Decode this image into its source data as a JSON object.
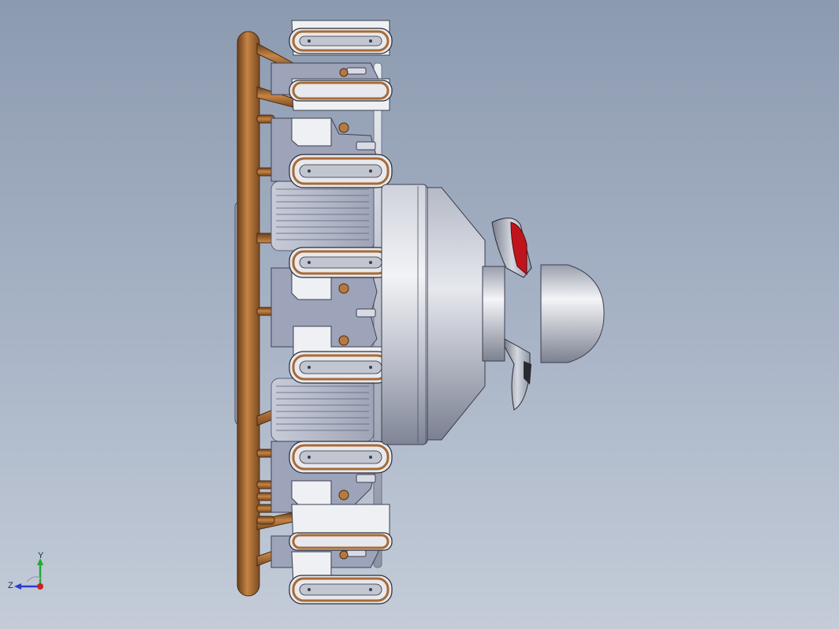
{
  "viewport": {
    "background_top": "#8c9ab0",
    "background_bottom": "#c4ccd8"
  },
  "colors": {
    "copper": "#a76a36",
    "copper_light": "#d59a5e",
    "steel": "#c9ccd6",
    "steel_dark": "#8f95a8",
    "blade_red": "#c0141c",
    "spinner": "#d7dae0",
    "dark_outline": "#2c2c34"
  },
  "model": {
    "name_icon": "radial-engine-model",
    "cylinder_count": 8,
    "propeller": "propeller-with-spinner"
  },
  "triad": {
    "y_label": "Y",
    "z_label": "Z"
  }
}
